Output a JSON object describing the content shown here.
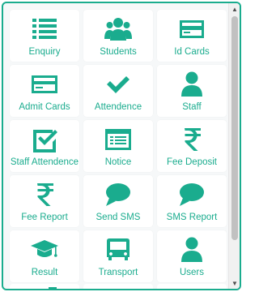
{
  "tiles": [
    {
      "label": "Enquiry",
      "icon": "list-icon"
    },
    {
      "label": "Students",
      "icon": "group-users-icon"
    },
    {
      "label": "Id Cards",
      "icon": "id-card-icon"
    },
    {
      "label": "Admit Cards",
      "icon": "card-icon"
    },
    {
      "label": "Attendence",
      "icon": "check-icon"
    },
    {
      "label": "Staff",
      "icon": "user-icon"
    },
    {
      "label": "Staff Attendence",
      "icon": "check-square-icon"
    },
    {
      "label": "Notice",
      "icon": "notice-board-icon"
    },
    {
      "label": "Fee Deposit",
      "icon": "rupee-icon"
    },
    {
      "label": "Fee Report",
      "icon": "rupee-icon"
    },
    {
      "label": "Send SMS",
      "icon": "chat-bubble-icon"
    },
    {
      "label": "SMS Report",
      "icon": "chat-bubble-icon"
    },
    {
      "label": "Result",
      "icon": "graduation-cap-icon"
    },
    {
      "label": "Transport",
      "icon": "bus-icon"
    },
    {
      "label": "Users",
      "icon": "user-icon"
    }
  ],
  "scrollbar": {
    "up": "▲",
    "down": "▼"
  },
  "colors": {
    "accent": "#1aac8e",
    "tile_bg": "#ffffff",
    "panel_bg": "#f6f8f9"
  }
}
